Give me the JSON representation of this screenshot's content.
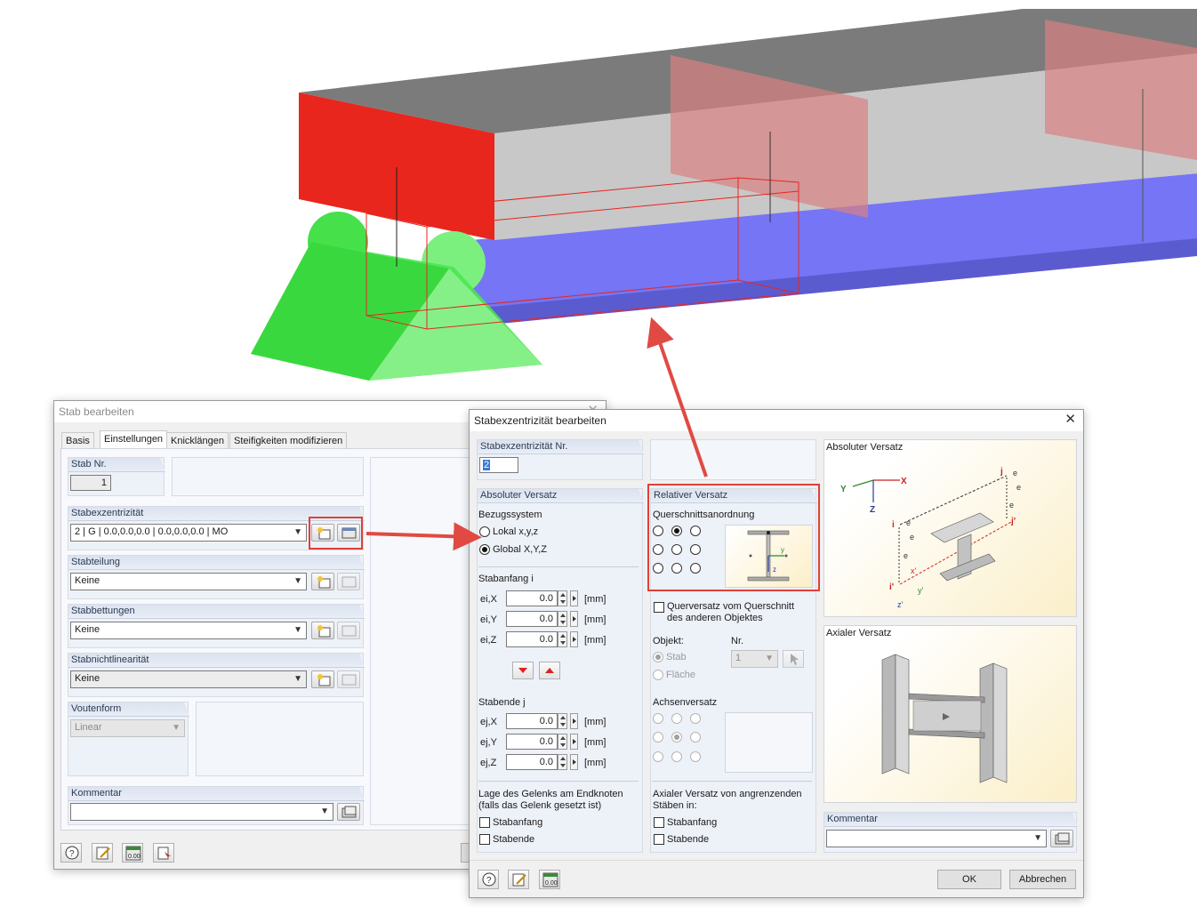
{
  "scene": {
    "colors": {
      "red": "#e8261d",
      "blue": "#7575ff",
      "green": "#39e63f",
      "gray": "#8a8a8a",
      "arrow": "#e04a43"
    }
  },
  "stab_dialog": {
    "title": "Stab bearbeiten",
    "tabs": [
      "Basis",
      "Einstellungen",
      "Knicklängen",
      "Steifigkeiten modifizieren"
    ],
    "active_tab": "Einstellungen",
    "stab_nr": {
      "label": "Stab Nr.",
      "value": "1"
    },
    "stabexzentrizitaet": {
      "label": "Stabexzentrizität",
      "value": "2 | G | 0.0,0.0,0.0 | 0.0,0.0,0.0 | MO"
    },
    "stabteilung": {
      "label": "Stabteilung",
      "value": "Keine"
    },
    "stabbettungen": {
      "label": "Stabbettungen",
      "value": "Keine"
    },
    "stabnichtlinearitaet": {
      "label": "Stabnichtlinearität",
      "value": "Keine"
    },
    "voutenform": {
      "label": "Voutenform",
      "value": "Linear"
    },
    "kommentar": {
      "label": "Kommentar",
      "value": ""
    }
  },
  "ecc_dialog": {
    "title": "Stabexzentrizität bearbeiten",
    "nr": {
      "label": "Stabexzentrizität Nr.",
      "value": "2"
    },
    "absoluter_versatz": {
      "label": "Absoluter Versatz",
      "bezugssystem_label": "Bezugssystem",
      "lokal_label": "Lokal x,y,z",
      "global_label": "Global X,Y,Z",
      "selected": "Global X,Y,Z",
      "stabanfang_label": "Stabanfang i",
      "stabende_label": "Stabende j",
      "start": [
        {
          "label": "ei,X",
          "value": "0.0",
          "unit": "[mm]"
        },
        {
          "label": "ei,Y",
          "value": "0.0",
          "unit": "[mm]"
        },
        {
          "label": "ei,Z",
          "value": "0.0",
          "unit": "[mm]"
        }
      ],
      "end": [
        {
          "label": "ej,X",
          "value": "0.0",
          "unit": "[mm]"
        },
        {
          "label": "ej,Y",
          "value": "0.0",
          "unit": "[mm]"
        },
        {
          "label": "ej,Z",
          "value": "0.0",
          "unit": "[mm]"
        }
      ],
      "gelenk_label": "Lage des Gelenks am Endknoten (falls das Gelenk gesetzt ist)",
      "stabanfang_check": "Stabanfang",
      "stabende_check": "Stabende"
    },
    "relativer_versatz": {
      "label": "Relativer Versatz",
      "querschnitt_label": "Querschnittsanordnung",
      "querversatz_label": "Querversatz vom Querschnitt des anderen Objektes",
      "objekt_label": "Objekt:",
      "nr_label": "Nr.",
      "nr_value": "1",
      "stab_label": "Stab",
      "flaeche_label": "Fläche",
      "achsenversatz_label": "Achsenversatz",
      "axial_label": "Axialer Versatz von angrenzenden Stäben in:",
      "stabanfang_check": "Stabanfang",
      "stabende_check": "Stabende"
    },
    "graphics": {
      "absolute_title": "Absoluter Versatz",
      "axial_title": "Axialer Versatz"
    },
    "kommentar": {
      "label": "Kommentar",
      "value": ""
    },
    "ok_label": "OK",
    "cancel_label": "Abbrechen"
  }
}
